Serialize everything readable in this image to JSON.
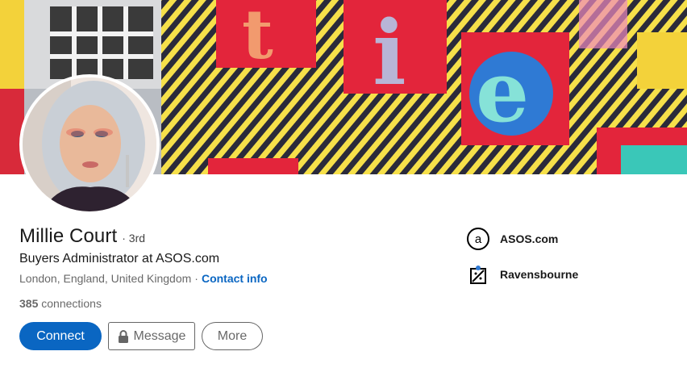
{
  "profile": {
    "name": "Millie Court",
    "degree": "· 3rd",
    "headline": "Buyers Administrator at ASOS.com",
    "location": "London, England, United Kingdom",
    "dot": "·",
    "contact_info": "Contact info",
    "connections_count": "385",
    "connections_label": "connections"
  },
  "actions": {
    "connect": "Connect",
    "message": "Message",
    "more": "More"
  },
  "sidebar": {
    "company": "ASOS.com",
    "school": "Ravensbourne"
  },
  "colors": {
    "accent": "#0a66c2"
  }
}
